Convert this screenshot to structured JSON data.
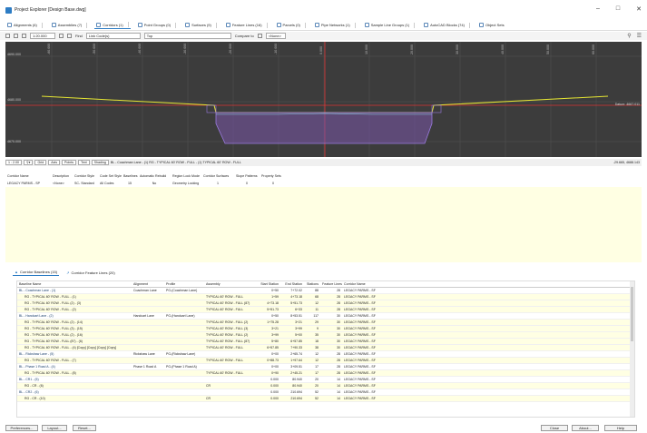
{
  "window": {
    "title": "Project Explorer [Design Base.dwg]"
  },
  "tabs": [
    {
      "label": "Alignments (6)"
    },
    {
      "label": "Assemblies (7)"
    },
    {
      "label": "Corridors (1)"
    },
    {
      "label": "Point Groups (0)"
    },
    {
      "label": "Surfaces (9)"
    },
    {
      "label": "Feature Lines (16)"
    },
    {
      "label": "Parcels (0)"
    },
    {
      "label": "Pipe Networks (1)"
    },
    {
      "label": "Sample Line Groups (1)"
    },
    {
      "label": "AutoCAD Blocks (74)"
    },
    {
      "label": "Object Sets"
    }
  ],
  "toolbar": {
    "scale": "1:20.000",
    "find_label": "Find",
    "find_value": "Link Code(s)",
    "view_value": "Top",
    "compare_label": "Compare to",
    "compare_value": "<None>"
  },
  "viewport": {
    "elevation_labels": [
      "4690.000",
      "4680.000",
      "4670.000"
    ],
    "datum_label": "Datum: 4667.011",
    "offset_labels": [
      "-60.000",
      "-50.000",
      "-40.000",
      "-30.000",
      "-20.000",
      "-10.000",
      "0.000",
      "10.000",
      "20.000",
      "30.000",
      "40.000",
      "50.000",
      "60.000"
    ]
  },
  "status_bar": {
    "zoom": "1 : 2.00",
    "buttons": [
      "Grid",
      "Axis",
      "Points",
      "Text",
      "Shading"
    ],
    "crumbs": "BL - Coachman Lane - (1)   RG - TYPICAL 60' ROW - FULL - (1)   TYPICAL 60' ROW - FULL",
    "readout": "-29.665, 4688.143"
  },
  "corridor_grid": {
    "headers": [
      "Corridor Name",
      "Description",
      "Corridor Style",
      "Code Set Style",
      "Baselines",
      "Automatic Rebuild",
      "Region Lock Mode",
      "Corridor Surfaces",
      "Slope Patterns",
      "Property Sets"
    ],
    "row": [
      "LEGACY PARMS - SP",
      "<None>",
      "SC- Standard",
      "All Codes",
      "15",
      "No",
      "Geometry Locking",
      "1",
      "0",
      "0"
    ]
  },
  "lower_tabs": [
    {
      "label": "Corridor Baselines (15)"
    },
    {
      "label": "Corridor Feature Lines (20)"
    }
  ],
  "baseline_table": {
    "headers": [
      "Baseline Name",
      "Alignment",
      "Profile",
      "Assembly",
      "Start Station",
      "End Station",
      "Stations",
      "Feature Lines",
      "Corridor Name"
    ],
    "rows": [
      {
        "c": [
          "BL - Coachman Lane - (1)",
          "Coachman Lane",
          "PG-(Coachman Lane)",
          "",
          "0+50",
          "7+72.02",
          "88",
          "28",
          "LEGACY PARMS - SF"
        ],
        "grp": true
      },
      {
        "c": [
          "RG - TYPICAL 60' ROW - FULL - (1)",
          "",
          "",
          "TYPICAL 60' ROW - FULL",
          "1+59",
          "4+73.18",
          "68",
          "28",
          "LEGACY PARMS - SF"
        ],
        "grp": false
      },
      {
        "c": [
          "RG - TYPICAL 60' ROW - FULL (2) - (3)",
          "",
          "",
          "TYPICAL 60' ROW - FULL (87)",
          "4+73.18",
          "5+51.73",
          "12",
          "28",
          "LEGACY PARMS - SF"
        ],
        "grp": false
      },
      {
        "c": [
          "RG - TYPICAL 60' ROW - FULL - (2)",
          "",
          "",
          "TYPICAL 60' ROW - FULL",
          "5+51.73",
          "6+33",
          "11",
          "28",
          "LEGACY PARMS - SF"
        ],
        "grp": false
      },
      {
        "c": [
          "BL - Handcart Lane - (2)",
          "Handcart Lane",
          "PG-(Handcart Lane)",
          "",
          "0+50",
          "8+53.51",
          "117",
          "30",
          "LEGACY PARMS - SF"
        ],
        "grp": true
      },
      {
        "c": [
          "RG - TYPICAL 60' ROW - FULL (2) - (14)",
          "",
          "",
          "TYPICAL 60' ROW - FULL (2)",
          "1+75.28",
          "3+21",
          "29",
          "30",
          "LEGACY PARMS - SF"
        ],
        "grp": false
      },
      {
        "c": [
          "RG - TYPICAL 60' ROW - FULL (3) - (15)",
          "",
          "",
          "TYPICAL 60' ROW - FULL (3)",
          "3+21",
          "3+99",
          "9",
          "30",
          "LEGACY PARMS - SF"
        ],
        "grp": false
      },
      {
        "c": [
          "RG - TYPICAL 60' ROW - FULL (2) - (16)",
          "",
          "",
          "TYPICAL 60' ROW - FULL (2)",
          "3+99",
          "5+00",
          "35",
          "30",
          "LEGACY PARMS - SF"
        ],
        "grp": false
      },
      {
        "c": [
          "RG - TYPICAL 60' ROW - FULL (87) - (6)",
          "",
          "",
          "TYPICAL 60' ROW - FULL (87)",
          "5+80",
          "6+57.85",
          "18",
          "30",
          "LEGACY PARMS - SF"
        ],
        "grp": false
      },
      {
        "c": [
          "RG - TYPICAL 60' ROW - FULL - (4) [Copy] [Copy] [Copy] [Copy]",
          "",
          "",
          "TYPICAL 60' ROW - FULL",
          "6+57.85",
          "7+90.33",
          "38",
          "30",
          "LEGACY PARMS - SF"
        ],
        "grp": false
      },
      {
        "c": [
          "BL - Rickshaw Lane - (5)",
          "Rickshaw Lane",
          "PG-(Rickshaw Lane)",
          "",
          "0+00",
          "2+65.74",
          "12",
          "28",
          "LEGACY PARMS - SF"
        ],
        "grp": true
      },
      {
        "c": [
          "RG - TYPICAL 60' ROW - FULL - (7)",
          "",
          "",
          "TYPICAL 60' ROW - FULL",
          "0+88.73",
          "1+97.64",
          "12",
          "28",
          "LEGACY PARMS - SF"
        ],
        "grp": false
      },
      {
        "c": [
          "BL - Phase 1 Road A - (4)",
          "Phase 1 Road A",
          "PG-(Phase 1 Road A)",
          "",
          "0+00",
          "3+09.51",
          "17",
          "28",
          "LEGACY PARMS - SF"
        ],
        "grp": true
      },
      {
        "c": [
          "RG - TYPICAL 60' ROW - FULL - (8)",
          "",
          "",
          "TYPICAL 60' ROW - FULL",
          "0+90",
          "2+45.21",
          "17",
          "28",
          "LEGACY PARMS - SF"
        ],
        "grp": false
      },
      {
        "c": [
          "BL - CR1 - (5)",
          "",
          "",
          "",
          "0.000",
          "80.940",
          "20",
          "14",
          "LEGACY PARMS - SF"
        ],
        "grp": true
      },
      {
        "c": [
          "RG - CR - (6)",
          "",
          "",
          "CR",
          "0.000",
          "80.940",
          "20",
          "14",
          "LEGACY PARMS - SF"
        ],
        "grp": false
      },
      {
        "c": [
          "BL - CR2 - (6)",
          "",
          "",
          "",
          "0.000",
          "210.694",
          "52",
          "14",
          "LEGACY PARMS - SF"
        ],
        "grp": true
      },
      {
        "c": [
          "RG - CR - (10)",
          "",
          "",
          "CR",
          "0.000",
          "210.694",
          "52",
          "14",
          "LEGACY PARMS - SF"
        ],
        "grp": false
      }
    ]
  },
  "footer": {
    "preferences": "Preferences...",
    "layout": "Layout...",
    "reset": "Reset...",
    "close": "Close",
    "about": "About...",
    "help": "Help"
  },
  "colors": {
    "accent": "#2d7cc4",
    "row_alt": "#ffffe3",
    "viewport_bg": "#3c3c3c"
  }
}
